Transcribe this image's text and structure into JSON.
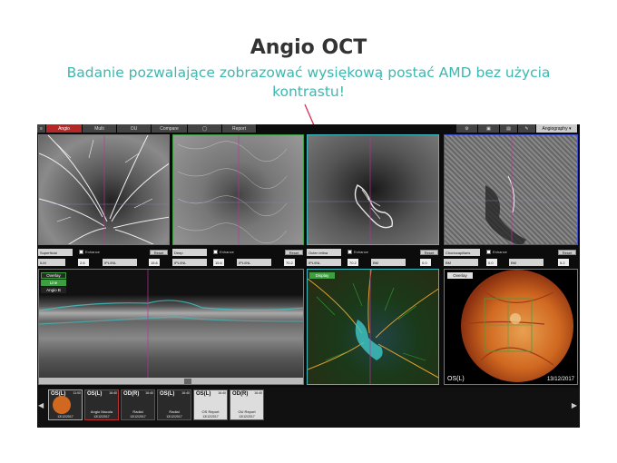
{
  "slide": {
    "title": "Angio OCT",
    "subtitle": "Badanie pozwalające zobrazować wysiękową postać AMD bez użycia kontrastu!"
  },
  "toolbar": {
    "tabs": [
      {
        "label": "Angio",
        "icon": "angio-icon"
      },
      {
        "label": "Multi",
        "icon": "multi-icon"
      },
      {
        "label": "OU",
        "icon": "ou-icon"
      },
      {
        "label": "Compare",
        "icon": "compare-icon"
      },
      {
        "label": "",
        "icon": "circle-icon"
      },
      {
        "label": "Report",
        "icon": "report-icon"
      }
    ],
    "mode_select": "Angiography"
  },
  "panels": [
    {
      "layer": "Superficial",
      "enhance": "Enhance",
      "reset": "Reset",
      "ref1": "ILM",
      "v1": "2.6",
      "ref2": "IPL/INL",
      "v2": "15.6"
    },
    {
      "layer": "Deep",
      "enhance": "Enhance",
      "reset": "Reset",
      "ref1": "IPL/INL",
      "v1": "15.6",
      "ref2": "IPL/INL",
      "v2": "70.2"
    },
    {
      "layer": "Outer retina",
      "enhance": "Enhance",
      "reset": "Reset",
      "ref1": "IPL/INL",
      "v1": "70.2",
      "ref2": "BM",
      "v2": "0.0"
    },
    {
      "layer": "Choriocapillaris",
      "enhance": "Enhance",
      "reset": "Reset",
      "ref1": "BM",
      "v1": "0.0",
      "ref2": "BM",
      "v2": "5.2"
    }
  ],
  "bscan": {
    "overlay_buttons": [
      "Overlay",
      "Line",
      "Angio B"
    ]
  },
  "enface": {
    "display_button": "Display"
  },
  "fundus": {
    "overlay_button": "Overlay",
    "eye": "OS(L)",
    "date": "13/12/2017"
  },
  "thumbnails": [
    {
      "eye": "OS(L)",
      "time": "11:00",
      "name": "",
      "date": "13/12/2017"
    },
    {
      "eye": "OS(L)",
      "time": "16:40",
      "name": "Angio Macula",
      "date": "13/12/2017"
    },
    {
      "eye": "OD(R)",
      "time": "16:40",
      "name": "Radial",
      "date": "13/12/2017"
    },
    {
      "eye": "OS(L)",
      "time": "16:40",
      "name": "Radial",
      "date": "13/12/2017"
    },
    {
      "eye": "OS(L)",
      "time": "16:40",
      "name": "OS Report",
      "date": "13/12/2017"
    },
    {
      "eye": "OD(R)",
      "time": "16:40",
      "name": "OU Report",
      "date": "13/12/2017"
    }
  ],
  "colors": {
    "accent_teal": "#3cb8b0",
    "arrow": "#d03050",
    "active_tab": "#b42828",
    "panel_frame_green": "#3ca040",
    "panel_frame_cyan": "#3cbcc0",
    "panel_frame_blue": "#4050c8"
  }
}
